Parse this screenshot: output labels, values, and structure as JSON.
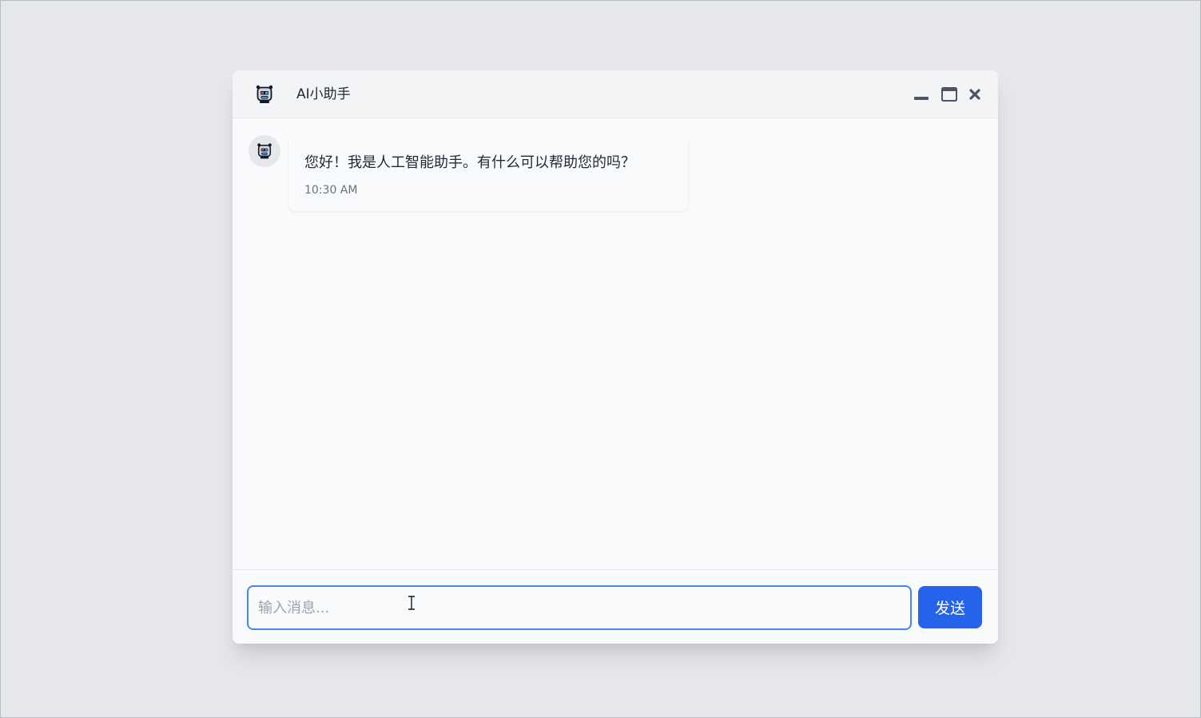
{
  "window": {
    "title": "AI小助手",
    "avatar_icon": "robot-icon",
    "controls": {
      "minimize_icon": "minimize-icon",
      "maximize_icon": "maximize-icon",
      "close_icon": "close-icon"
    }
  },
  "messages": [
    {
      "sender": "assistant",
      "avatar_icon": "robot-icon",
      "text": "您好！我是人工智能助手。有什么可以帮助您的吗？",
      "time": "10:30 AM"
    }
  ],
  "composer": {
    "placeholder": "输入消息...",
    "value": "",
    "send_label": "发送"
  },
  "colors": {
    "accent": "#2563eb",
    "input_focus_border": "#4a86e8",
    "background": "#e5e7eb",
    "header": "#f3f4f6"
  }
}
